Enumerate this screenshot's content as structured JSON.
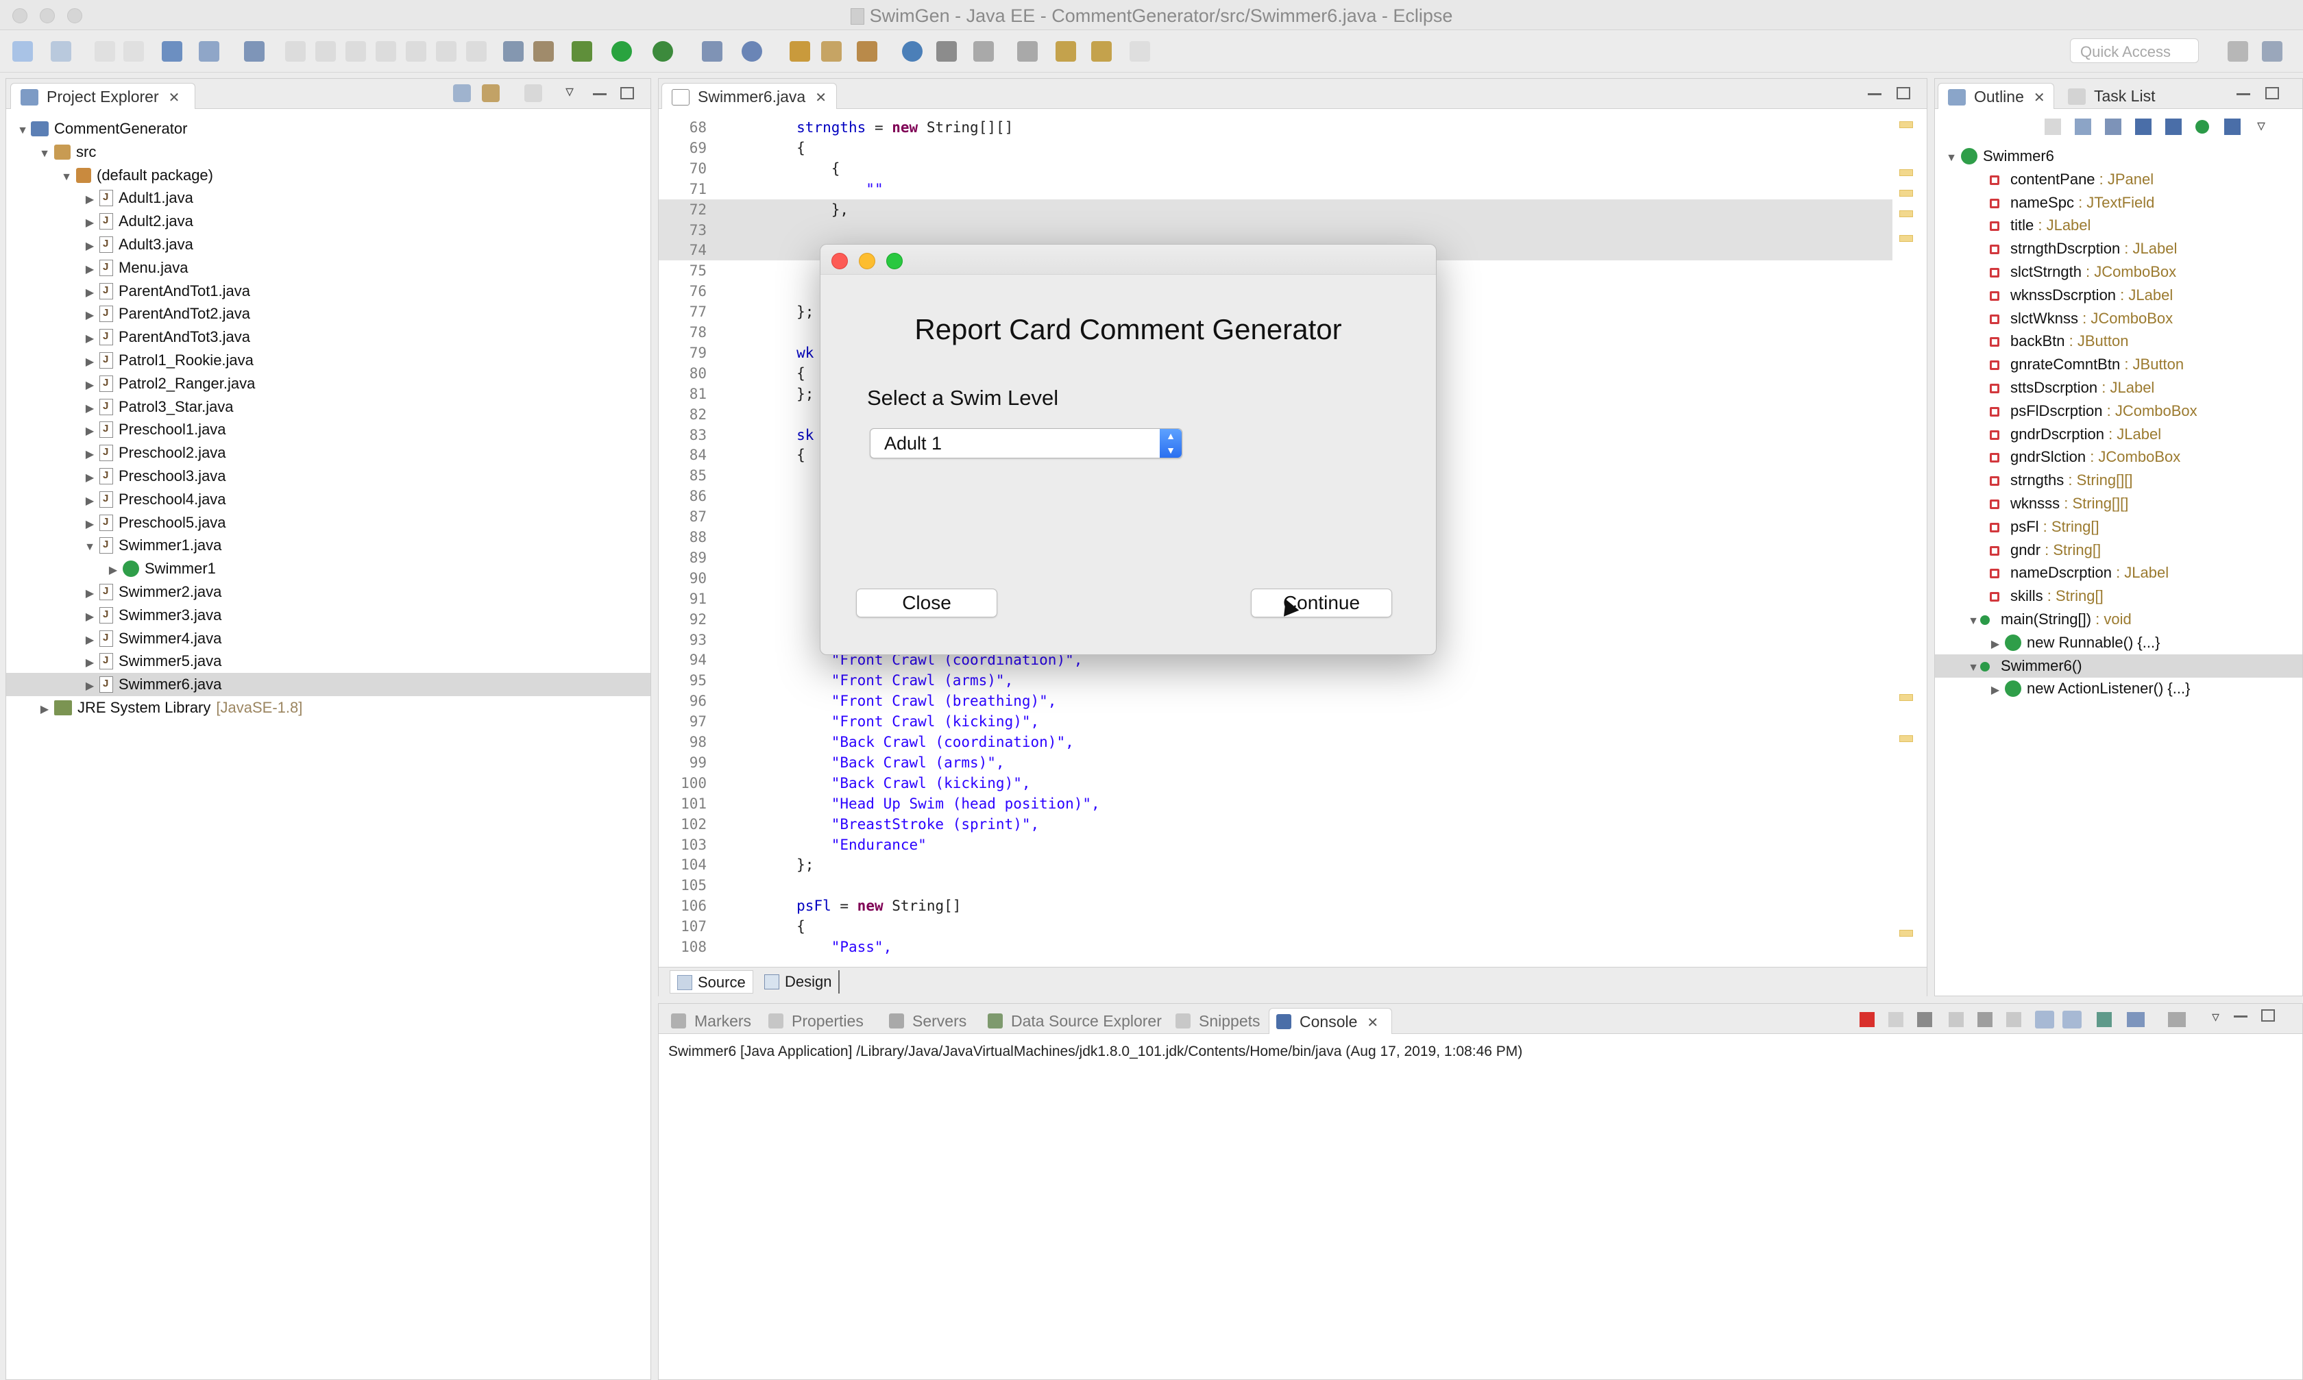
{
  "window": {
    "title": "SwimGen - Java EE - CommentGenerator/src/Swimmer6.java - Eclipse"
  },
  "toolbar": {
    "quick_access_placeholder": "Quick Access"
  },
  "project_explorer": {
    "tab_label": "Project Explorer",
    "project": "CommentGenerator",
    "src": "src",
    "package": "(default package)",
    "files": [
      "Adult1.java",
      "Adult2.java",
      "Adult3.java",
      "Menu.java",
      "ParentAndTot1.java",
      "ParentAndTot2.java",
      "ParentAndTot3.java",
      "Patrol1_Rookie.java",
      "Patrol2_Ranger.java",
      "Patrol3_Star.java",
      "Preschool1.java",
      "Preschool2.java",
      "Preschool3.java",
      "Preschool4.java",
      "Preschool5.java",
      "Swimmer1.java"
    ],
    "swimmer1_class": "Swimmer1",
    "files_after": [
      "Swimmer2.java",
      "Swimmer3.java",
      "Swimmer4.java",
      "Swimmer5.java",
      "Swimmer6.java"
    ],
    "jre_label": "JRE System Library",
    "jre_version": "[JavaSE-1.8]"
  },
  "editor": {
    "tab_label": "Swimmer6.java",
    "bottom_tabs": [
      "Source",
      "Design"
    ],
    "lines": [
      {
        "n": "68",
        "indent": "        ",
        "parts": [
          {
            "t": "strngths",
            "c": "fld"
          },
          {
            "t": " = "
          },
          {
            "t": "new",
            "c": "kw"
          },
          {
            "t": " String[][]"
          }
        ]
      },
      {
        "n": "69",
        "indent": "        ",
        "parts": [
          {
            "t": "{"
          }
        ]
      },
      {
        "n": "70",
        "indent": "            ",
        "parts": [
          {
            "t": "{"
          }
        ]
      },
      {
        "n": "71",
        "indent": "                ",
        "parts": [
          {
            "t": "\"\"",
            "c": "str"
          }
        ]
      },
      {
        "n": "72",
        "indent": "            ",
        "parts": [
          {
            "t": "},"
          }
        ]
      },
      {
        "n": "73",
        "indent": "",
        "parts": []
      },
      {
        "n": "74",
        "indent": "",
        "parts": []
      },
      {
        "n": "75",
        "indent": "",
        "parts": []
      },
      {
        "n": "76",
        "indent": "",
        "parts": []
      },
      {
        "n": "77",
        "indent": "        ",
        "parts": [
          {
            "t": "};"
          }
        ]
      },
      {
        "n": "78",
        "indent": "",
        "parts": []
      },
      {
        "n": "79",
        "indent": "        ",
        "parts": [
          {
            "t": "wk",
            "c": "fld"
          }
        ]
      },
      {
        "n": "80",
        "indent": "        ",
        "parts": [
          {
            "t": "{"
          }
        ]
      },
      {
        "n": "81",
        "indent": "        ",
        "parts": [
          {
            "t": "};"
          }
        ]
      },
      {
        "n": "82",
        "indent": "",
        "parts": []
      },
      {
        "n": "83",
        "indent": "        ",
        "parts": [
          {
            "t": "sk",
            "c": "fld"
          }
        ]
      },
      {
        "n": "84",
        "indent": "        ",
        "parts": [
          {
            "t": "{"
          }
        ]
      },
      {
        "n": "85",
        "indent": "",
        "parts": []
      },
      {
        "n": "86",
        "indent": "",
        "parts": []
      },
      {
        "n": "87",
        "indent": "",
        "parts": []
      },
      {
        "n": "88",
        "indent": "",
        "parts": []
      },
      {
        "n": "89",
        "indent": "",
        "parts": []
      },
      {
        "n": "90",
        "indent": "",
        "parts": []
      },
      {
        "n": "91",
        "indent": "",
        "parts": []
      },
      {
        "n": "92",
        "indent": "",
        "parts": []
      },
      {
        "n": "93",
        "indent": "",
        "parts": []
      },
      {
        "n": "94",
        "indent": "            ",
        "parts": [
          {
            "t": "\"Front Crawl (coordination)\",",
            "c": "str"
          }
        ]
      },
      {
        "n": "95",
        "indent": "            ",
        "parts": [
          {
            "t": "\"Front Crawl (arms)\",",
            "c": "str"
          }
        ]
      },
      {
        "n": "96",
        "indent": "            ",
        "parts": [
          {
            "t": "\"Front Crawl (breathing)\",",
            "c": "str"
          }
        ]
      },
      {
        "n": "97",
        "indent": "            ",
        "parts": [
          {
            "t": "\"Front Crawl (kicking)\",",
            "c": "str"
          }
        ]
      },
      {
        "n": "98",
        "indent": "            ",
        "parts": [
          {
            "t": "\"Back Crawl (coordination)\",",
            "c": "str"
          }
        ]
      },
      {
        "n": "99",
        "indent": "            ",
        "parts": [
          {
            "t": "\"Back Crawl (arms)\",",
            "c": "str"
          }
        ]
      },
      {
        "n": "100",
        "indent": "            ",
        "parts": [
          {
            "t": "\"Back Crawl (kicking)\",",
            "c": "str"
          }
        ]
      },
      {
        "n": "101",
        "indent": "            ",
        "parts": [
          {
            "t": "\"Head Up Swim (head position)\",",
            "c": "str"
          }
        ]
      },
      {
        "n": "102",
        "indent": "            ",
        "parts": [
          {
            "t": "\"BreastStroke (sprint)\",",
            "c": "str"
          }
        ]
      },
      {
        "n": "103",
        "indent": "            ",
        "parts": [
          {
            "t": "\"Endurance\"",
            "c": "str"
          }
        ]
      },
      {
        "n": "104",
        "indent": "        ",
        "parts": [
          {
            "t": "};"
          }
        ]
      },
      {
        "n": "105",
        "indent": "",
        "parts": []
      },
      {
        "n": "106",
        "indent": "        ",
        "parts": [
          {
            "t": "psFl",
            "c": "fld"
          },
          {
            "t": " = "
          },
          {
            "t": "new",
            "c": "kw"
          },
          {
            "t": " String[]"
          }
        ]
      },
      {
        "n": "107",
        "indent": "        ",
        "parts": [
          {
            "t": "{"
          }
        ]
      },
      {
        "n": "108",
        "indent": "            ",
        "parts": [
          {
            "t": "\"Pass\",",
            "c": "str"
          }
        ]
      }
    ]
  },
  "outline": {
    "tab_label": "Outline",
    "task_tab_label": "Task List",
    "class_name": "Swimmer6",
    "members": [
      {
        "name": "contentPane",
        "type": " : JPanel"
      },
      {
        "name": "nameSpc",
        "type": " : JTextField"
      },
      {
        "name": "title",
        "type": " : JLabel"
      },
      {
        "name": "strngthDscrption",
        "type": " : JLabel"
      },
      {
        "name": "slctStrngth",
        "type": " : JComboBox"
      },
      {
        "name": "wknssDscrption",
        "type": " : JLabel"
      },
      {
        "name": "slctWknss",
        "type": " : JComboBox"
      },
      {
        "name": "backBtn",
        "type": " : JButton"
      },
      {
        "name": "gnrateComntBtn",
        "type": " : JButton"
      },
      {
        "name": "sttsDscrption",
        "type": " : JLabel"
      },
      {
        "name": "psFlDscrption",
        "type": " : JComboBox"
      },
      {
        "name": "gndrDscrption",
        "type": " : JLabel"
      },
      {
        "name": "gndrSlction",
        "type": " : JComboBox"
      },
      {
        "name": "strngths",
        "type": " : String[][]"
      },
      {
        "name": "wknsss",
        "type": " : String[][]"
      },
      {
        "name": "psFl",
        "type": " : String[]"
      },
      {
        "name": "gndr",
        "type": " : String[]"
      },
      {
        "name": "nameDscrption",
        "type": " : JLabel"
      },
      {
        "name": "skills",
        "type": " : String[]"
      }
    ],
    "main_method": "main(String[])",
    "main_type": " : void",
    "runnable": "new Runnable() {...}",
    "constructor": "Swimmer6()",
    "listener": "new ActionListener() {...}"
  },
  "console": {
    "tabs": [
      "Markers",
      "Properties",
      "Servers",
      "Data Source Explorer",
      "Snippets",
      "Console"
    ],
    "output": "Swimmer6 [Java Application] /Library/Java/JavaVirtualMachines/jdk1.8.0_101.jdk/Contents/Home/bin/java (Aug 17, 2019, 1:08:46 PM)"
  },
  "dialog": {
    "heading": "Report Card Comment Generator",
    "label": "Select a Swim Level",
    "selected_level": "Adult 1",
    "close_label": "Close",
    "continue_label": "Continue"
  }
}
